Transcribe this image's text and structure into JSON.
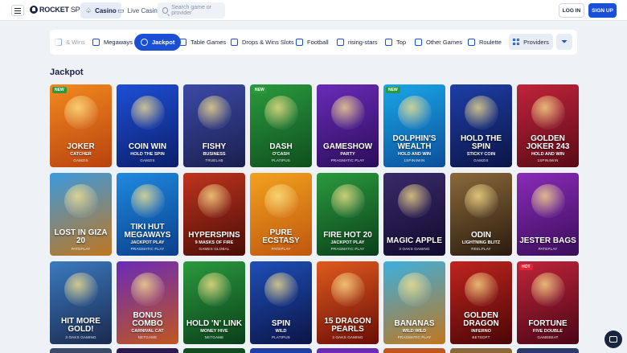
{
  "header": {
    "logo_left": "ROCKET",
    "logo_right": "SPIN",
    "tabs": [
      {
        "label": "Casino",
        "active": true
      },
      {
        "label": "Live Casino",
        "active": false
      }
    ],
    "search_placeholder": "Search game or provider",
    "login_label": "LOG IN",
    "signup_label": "SIGN UP"
  },
  "categories": [
    {
      "label": "& Wins",
      "icon": "drops-icon"
    },
    {
      "label": "Megaways",
      "icon": "megaways-icon"
    },
    {
      "label": "Jackpot",
      "icon": "jackpot-icon",
      "active": true
    },
    {
      "label": "Table Games",
      "icon": "table-icon"
    },
    {
      "label": "Drops & Wins Slots",
      "icon": "drops-icon"
    },
    {
      "label": "Football",
      "icon": "football-icon"
    },
    {
      "label": "rising-stars",
      "icon": "star-icon"
    },
    {
      "label": "Top",
      "icon": "flame-icon"
    },
    {
      "label": "Other Games",
      "icon": "dice-icon"
    },
    {
      "label": "Roulette",
      "icon": "roulette-icon"
    }
  ],
  "providers_label": "Providers",
  "section_title": "Jackpot",
  "games": [
    {
      "title": "JOKER",
      "sub": "CATCHER",
      "provider": "GAMZIX",
      "badge": "NEW",
      "color1": "#f28a1e",
      "color2": "#b8420f"
    },
    {
      "title": "COIN WIN",
      "sub": "HOLD THE SPIN",
      "provider": "GAMZIX",
      "badge": "",
      "color1": "#1e4fd6",
      "color2": "#0b1f6b"
    },
    {
      "title": "FISHY",
      "sub": "BUSINESS",
      "provider": "TRUELAB",
      "badge": "",
      "color1": "#3b4aa8",
      "color2": "#1b1f4e"
    },
    {
      "title": "DASH",
      "sub": "O'CASH",
      "provider": "PLATIPUS",
      "badge": "NEW",
      "color1": "#2a9a3d",
      "color2": "#0f4f1e"
    },
    {
      "title": "GAMESHOW",
      "sub": "PARTY",
      "provider": "PRAGMATIC PLAY",
      "badge": "",
      "color1": "#6a2bb8",
      "color2": "#2a0d5a"
    },
    {
      "title": "DOLPHIN'S WEALTH",
      "sub": "HOLD AND WIN",
      "provider": "1SPIN4WIN",
      "badge": "NEW",
      "color1": "#1aa7e8",
      "color2": "#0b4f9a"
    },
    {
      "title": "HOLD THE SPIN",
      "sub": "STICKY COIN",
      "provider": "GAMZIX",
      "badge": "",
      "color1": "#1e3fa8",
      "color2": "#0b1446"
    },
    {
      "title": "GOLDEN JOKER 243",
      "sub": "HOLD AND WIN",
      "provider": "1SPIN4WIN",
      "badge": "",
      "color1": "#c0243a",
      "color2": "#5a0a16"
    },
    {
      "title": "LOST IN GIZA 20",
      "sub": "",
      "provider": "PATEPLAY",
      "badge": "",
      "color1": "#3b9ae0",
      "color2": "#c0761e"
    },
    {
      "title": "TIKI HUT MEGAWAYS",
      "sub": "JACKPOT PLAY",
      "provider": "PRAGMATIC PLAY",
      "badge": "",
      "color1": "#1e8ae0",
      "color2": "#0b3f8a"
    },
    {
      "title": "HYPERSPINS",
      "sub": "9 MASKS OF FIRE",
      "provider": "GAMES GLOBAL",
      "badge": "",
      "color1": "#c0341e",
      "color2": "#4a0d06"
    },
    {
      "title": "PURE ECSTASY",
      "sub": "",
      "provider": "PATEPLAY",
      "badge": "",
      "color1": "#f2a21e",
      "color2": "#c0560f"
    },
    {
      "title": "FIRE HOT 20",
      "sub": "JACKPOT PLAY",
      "provider": "PRAGMATIC PLAY",
      "badge": "",
      "color1": "#2a9a3d",
      "color2": "#0b3f1a"
    },
    {
      "title": "MAGIC APPLE",
      "sub": "",
      "provider": "3 OAKS GAMING",
      "badge": "",
      "color1": "#3a2a6a",
      "color2": "#120a2e"
    },
    {
      "title": "ODIN",
      "sub": "LIGHTNING BLITZ",
      "provider": "REELPLAY",
      "badge": "",
      "color1": "#8a6a3a",
      "color2": "#2a1a0e"
    },
    {
      "title": "JESTER BAGS",
      "sub": "",
      "provider": "PATEPLAY",
      "badge": "",
      "color1": "#8a2bb8",
      "color2": "#3a0d5a"
    },
    {
      "title": "HIT MORE GOLD!",
      "sub": "",
      "provider": "3 OAKS GAMING",
      "badge": "",
      "color1": "#3b7ac0",
      "color2": "#1a2a4e"
    },
    {
      "title": "BONUS COMBO",
      "sub": "CARNIVAL CAT",
      "provider": "NETGAME",
      "badge": "",
      "color1": "#6a2bb8",
      "color2": "#c0561e"
    },
    {
      "title": "HOLD 'N' LINK",
      "sub": "MONEY HIVE",
      "provider": "NETGAME",
      "badge": "",
      "color1": "#2a9a3d",
      "color2": "#0b3f1a"
    },
    {
      "title": "SPIN",
      "sub": "WILD",
      "provider": "PLATIPUS",
      "badge": "",
      "color1": "#1e4fb8",
      "color2": "#0b1446"
    },
    {
      "title": "15 DRAGON PEARLS",
      "sub": "",
      "provider": "3 OAKS GAMING",
      "badge": "",
      "color1": "#e05a1e",
      "color2": "#6a0d06"
    },
    {
      "title": "BANANAS",
      "sub": "WILD WILD",
      "provider": "PRAGMATIC PLAY",
      "badge": "",
      "color1": "#3bb0e0",
      "color2": "#c0761e"
    },
    {
      "title": "GOLDEN DRAGON",
      "sub": "INFERNO",
      "provider": "BETSOFT",
      "badge": "",
      "color1": "#c0241e",
      "color2": "#4a0606"
    },
    {
      "title": "FORTUNE",
      "sub": "FIVE DOUBLE",
      "provider": "GAMEBEAT",
      "badge": "HOT",
      "color1": "#c0243a",
      "color2": "#4a0616"
    }
  ],
  "partial_row_colors": [
    "#3a4a6a",
    "#2a1a4e",
    "#0f4f1e",
    "#1e3fa8",
    "#6a2bb8",
    "#c0561e",
    "#8a6a3a",
    "#2a3a6a"
  ]
}
